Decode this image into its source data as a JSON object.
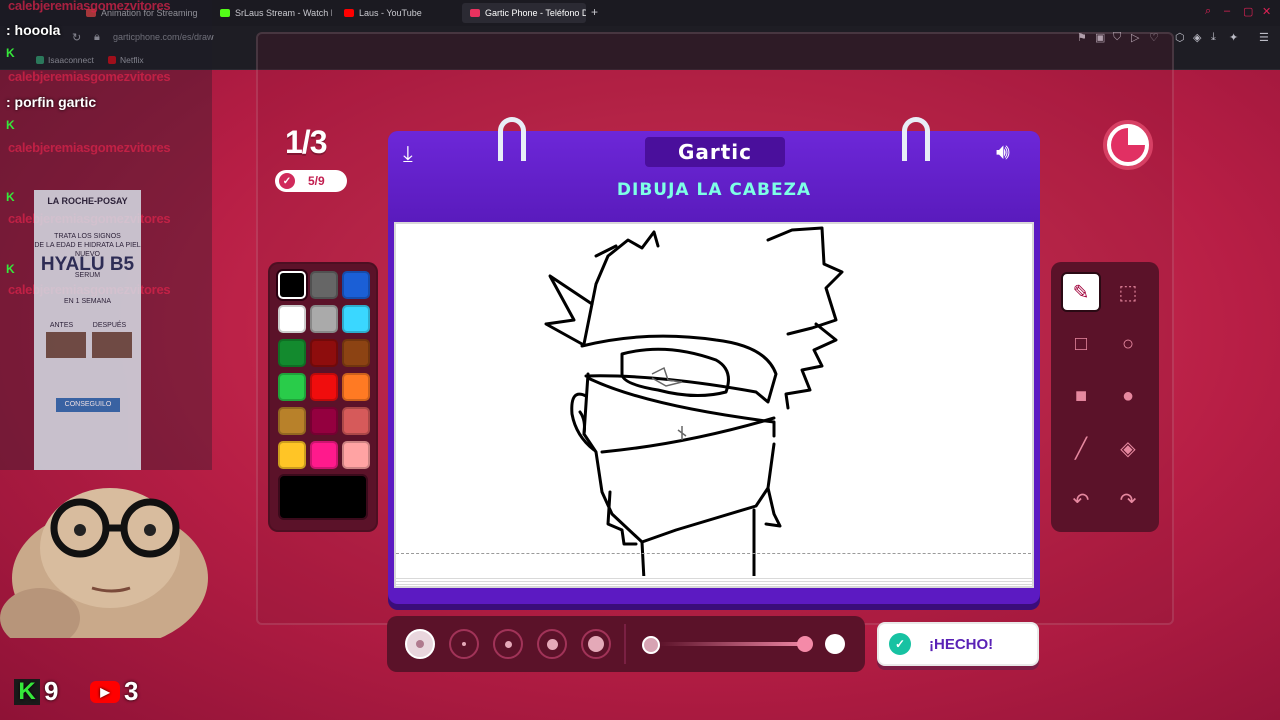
{
  "browser": {
    "tabs": [
      {
        "label": "Animation for Streaming",
        "color": "#e44"
      },
      {
        "label": "SrLaus Stream - Watch Li",
        "color": "#53fc18"
      },
      {
        "label": "Laus - YouTube",
        "color": "#ff0000"
      },
      {
        "label": "Gartic Phone - Teléfono D",
        "color": "#e9325f"
      }
    ],
    "url": "garticphone.com/es/draw",
    "bookmarks": [
      "Isaaconnect",
      "Netflix"
    ]
  },
  "game": {
    "round": "1/3",
    "players_done": "5/9",
    "logo": "Gartic",
    "prompt": "DIBUJA LA CABEZA",
    "done_label": "¡HECHO!",
    "download_icon": "download-icon",
    "sound_icon": "speaker-icon",
    "timer_icon": "timer-icon",
    "palette": [
      "#000000",
      "#666666",
      "#1b5fd6",
      "#ffffff",
      "#aaaaaa",
      "#3ad7ff",
      "#138a2e",
      "#8e0d0d",
      "#8c4313",
      "#29cc4a",
      "#f00d0d",
      "#ff7a23",
      "#b8812a",
      "#94003f",
      "#d65a5a",
      "#ffc526",
      "#ff1a8c",
      "#ffa3a3"
    ],
    "selected_color": "#000000",
    "tools": [
      "pencil-icon",
      "bucket-icon",
      "rectangle-outline-icon",
      "circle-outline-icon",
      "rectangle-fill-icon",
      "circle-fill-icon",
      "line-icon",
      "fill-bucket-icon",
      "undo-icon",
      "redo-icon"
    ],
    "brush_sizes": 5
  },
  "stream": {
    "chat": [
      {
        "user": "calebjeremiasgomezvitores",
        "msg": ": hooola"
      },
      {
        "user": "calebjeremiasgomezvitores",
        "msg": ": porfin gartic"
      },
      {
        "user": "calebjeremiasgomezvitores",
        "msg": ""
      },
      {
        "user": "calebjeremiasgomezvitores",
        "msg": ""
      },
      {
        "user": "calebjeremiasgomezvitores",
        "msg": ""
      },
      {
        "user": "calebjeremiasgomezvitores",
        "msg": ""
      }
    ],
    "ad": {
      "brand": "LA ROCHE-POSAY",
      "line1": "TRATA LOS SIGNOS",
      "line2": "DE LA EDAD E HIDRATA LA PIEL",
      "line3": "NUEVO",
      "product": "HYALU B5",
      "serum": "SERUM",
      "week": "EN 1 SEMANA",
      "before": "ANTES",
      "after": "DESPUÉS",
      "cta": "CONSEGUILO"
    },
    "kick_viewers": "9",
    "youtube_viewers": "3"
  }
}
